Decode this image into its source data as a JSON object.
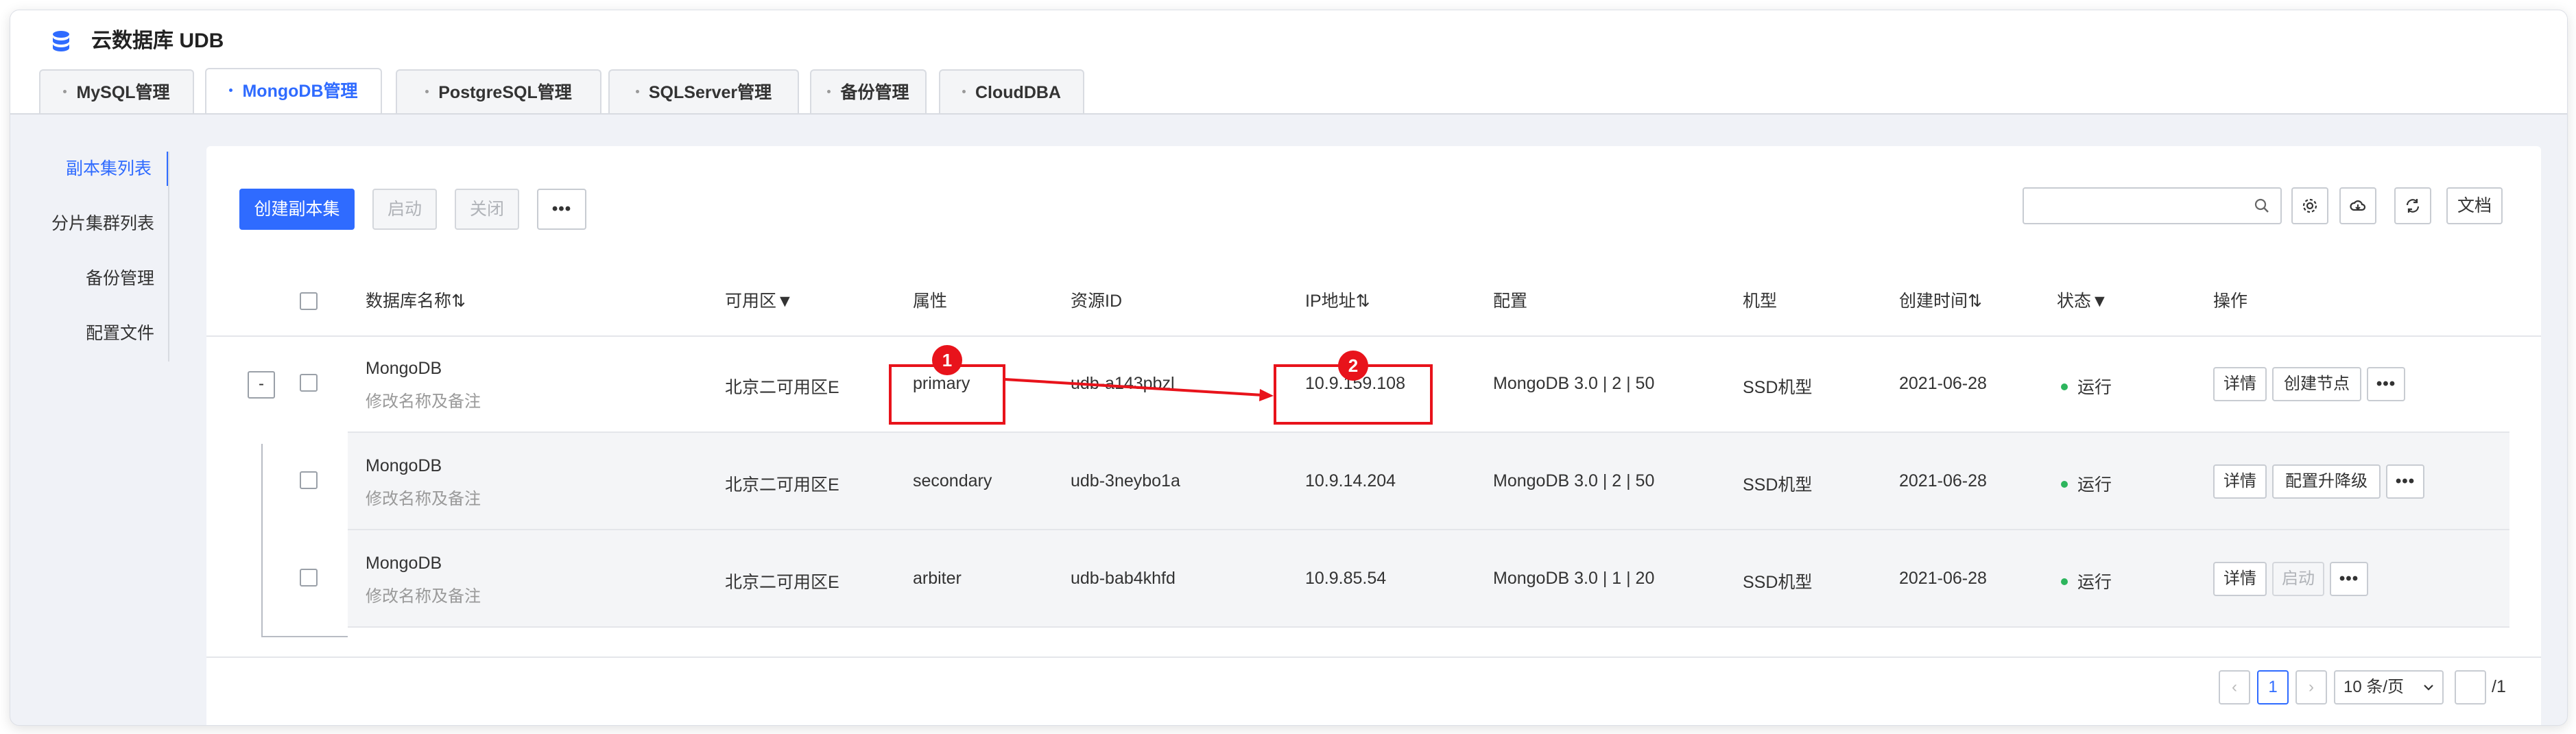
{
  "app": {
    "title": "云数据库 UDB"
  },
  "tabs": [
    {
      "label": "MySQL管理",
      "active": false
    },
    {
      "label": "MongoDB管理",
      "active": true
    },
    {
      "label": "PostgreSQL管理",
      "active": false
    },
    {
      "label": "SQLServer管理",
      "active": false
    },
    {
      "label": "备份管理",
      "active": false
    },
    {
      "label": "CloudDBA",
      "active": false
    }
  ],
  "sidebar": {
    "items": [
      {
        "label": "副本集列表",
        "active": true
      },
      {
        "label": "分片集群列表",
        "active": false
      },
      {
        "label": "备份管理",
        "active": false
      },
      {
        "label": "配置文件",
        "active": false
      }
    ]
  },
  "toolbar": {
    "create_label": "创建副本集",
    "start_label": "启动",
    "close_label": "关闭",
    "more_label": "•••",
    "search_placeholder": "",
    "doc_label": "文档"
  },
  "table": {
    "headers": {
      "name": "数据库名称⇅",
      "zone": "可用区▼",
      "role": "属性",
      "resource_id": "资源ID",
      "ip": "IP地址⇅",
      "config": "配置",
      "model": "机型",
      "created": "创建时间⇅",
      "status": "状态▼",
      "actions": "操作"
    },
    "rows": [
      {
        "name": "MongoDB",
        "note": "修改名称及备注",
        "zone": "北京二可用区E",
        "role": "primary",
        "resource_id": "udb-a143pbzl",
        "ip": "10.9.159.108",
        "config": "MongoDB 3.0 | 2 | 50",
        "model": "SSD机型",
        "created": "2021-06-28",
        "status": "运行",
        "action1": "详情",
        "action2": "创建节点",
        "action_more": "•••"
      },
      {
        "name": "MongoDB",
        "note": "修改名称及备注",
        "zone": "北京二可用区E",
        "role": "secondary",
        "resource_id": "udb-3neybo1a",
        "ip": "10.9.14.204",
        "config": "MongoDB 3.0 | 2 | 50",
        "model": "SSD机型",
        "created": "2021-06-28",
        "status": "运行",
        "action1": "详情",
        "action2": "配置升降级",
        "action_more": "•••"
      },
      {
        "name": "MongoDB",
        "note": "修改名称及备注",
        "zone": "北京二可用区E",
        "role": "arbiter",
        "resource_id": "udb-bab4khfd",
        "ip": "10.9.85.54",
        "config": "MongoDB 3.0 | 1 | 20",
        "model": "SSD机型",
        "created": "2021-06-28",
        "status": "运行",
        "action1": "详情",
        "action2": "启动",
        "action_more": "•••"
      }
    ]
  },
  "annotations": {
    "badge1": "1",
    "badge2": "2",
    "expander": "-"
  },
  "pagination": {
    "prev": "‹",
    "current": "1",
    "next": "›",
    "page_size": "10 条/页",
    "total": "/1"
  },
  "colors": {
    "accent": "#2f6bff",
    "highlight": "#e8131b",
    "running": "#2db55d"
  }
}
